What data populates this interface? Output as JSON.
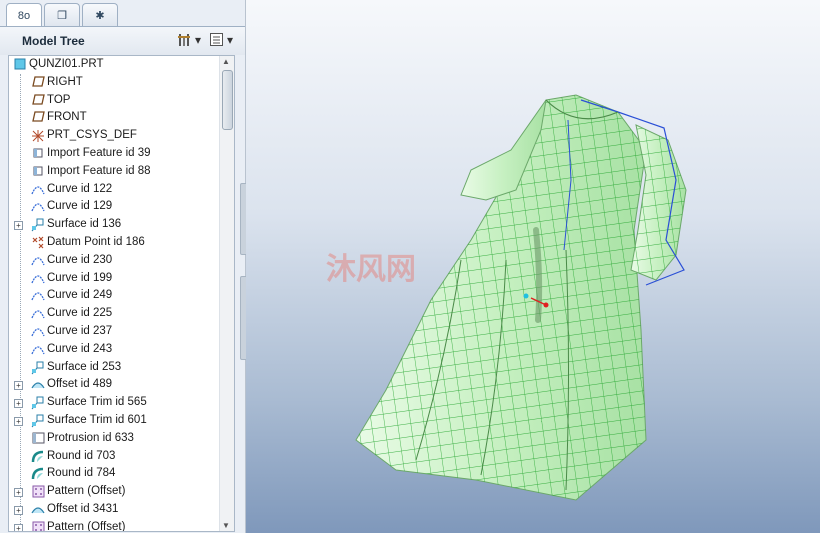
{
  "tabs": [
    {
      "name": "tree-tab",
      "icon": "tree-icon",
      "glyph": "8o"
    },
    {
      "name": "folder-tab",
      "icon": "folder-icon",
      "glyph": "❐"
    },
    {
      "name": "favorites-tab",
      "icon": "favorites-icon",
      "glyph": "✱"
    }
  ],
  "model_tree": {
    "title": "Model Tree",
    "settings_icon": "tree-settings-icon",
    "show_icon": "show-menu-icon",
    "root": {
      "label": "QUNZI01.PRT",
      "icon": "part-icon"
    },
    "items": [
      {
        "label": "RIGHT",
        "icon": "datum-plane-icon",
        "expand": false
      },
      {
        "label": "TOP",
        "icon": "datum-plane-icon",
        "expand": false
      },
      {
        "label": "FRONT",
        "icon": "datum-plane-icon",
        "expand": false
      },
      {
        "label": "PRT_CSYS_DEF",
        "icon": "csys-icon",
        "expand": false
      },
      {
        "label": "Import Feature id 39",
        "icon": "import-feature-icon",
        "expand": false
      },
      {
        "label": "Import Feature id 88",
        "icon": "import-feature-icon",
        "expand": false
      },
      {
        "label": "Curve id 122",
        "icon": "curve-icon",
        "expand": false
      },
      {
        "label": "Curve id 129",
        "icon": "curve-icon",
        "expand": false
      },
      {
        "label": "Surface id 136",
        "icon": "surface-icon",
        "expand": true
      },
      {
        "label": "Datum Point id 186",
        "icon": "datum-point-icon",
        "expand": false
      },
      {
        "label": "Curve id 230",
        "icon": "curve-icon",
        "expand": false
      },
      {
        "label": "Curve id 199",
        "icon": "curve-icon",
        "expand": false
      },
      {
        "label": "Curve id 249",
        "icon": "curve-icon",
        "expand": false
      },
      {
        "label": "Curve id 225",
        "icon": "curve-icon",
        "expand": false
      },
      {
        "label": "Curve id 237",
        "icon": "curve-icon",
        "expand": false
      },
      {
        "label": "Curve id 243",
        "icon": "curve-icon",
        "expand": false
      },
      {
        "label": "Surface id 253",
        "icon": "surface-icon",
        "expand": false
      },
      {
        "label": "Offset id 489",
        "icon": "offset-icon",
        "expand": true
      },
      {
        "label": "Surface Trim id 565",
        "icon": "surface-trim-icon",
        "expand": true
      },
      {
        "label": "Surface Trim id 601",
        "icon": "surface-trim-icon",
        "expand": true
      },
      {
        "label": "Protrusion id 633",
        "icon": "protrusion-icon",
        "expand": false
      },
      {
        "label": "Round id 703",
        "icon": "round-icon",
        "expand": false
      },
      {
        "label": "Round id 784",
        "icon": "round-icon",
        "expand": false
      },
      {
        "label": "Pattern (Offset)",
        "icon": "pattern-icon",
        "expand": true
      },
      {
        "label": "Offset id 3431",
        "icon": "offset-icon",
        "expand": true
      },
      {
        "label": "Pattern (Offset)",
        "icon": "pattern-icon",
        "expand": true
      }
    ]
  },
  "viewport": {
    "model": "dress-3d-model",
    "watermark": "沐风网",
    "colors": {
      "surface": "#c9f2c4",
      "mesh": "#1fa32a",
      "edge_blue": "#2a4fd6",
      "bg_top": "#f6f8fb",
      "bg_bottom": "#7f98bb"
    }
  }
}
